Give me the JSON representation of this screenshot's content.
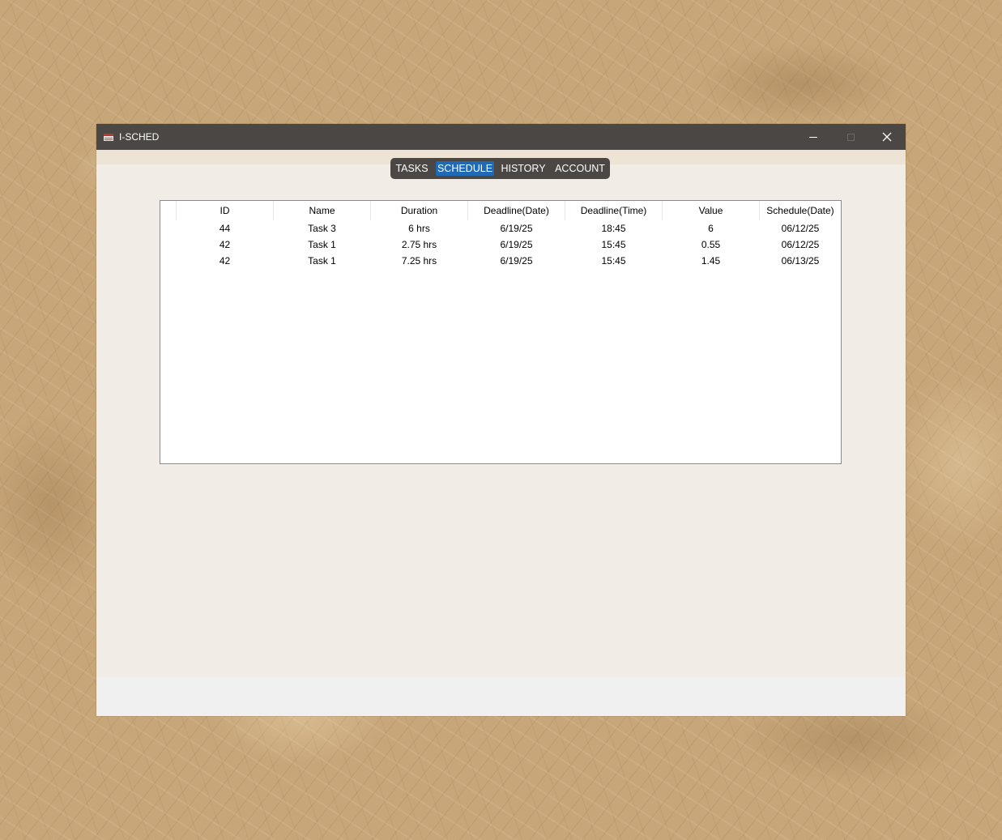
{
  "window": {
    "title": "I-SCHED"
  },
  "nav": {
    "tabs": [
      {
        "label": "TASKS",
        "active": false
      },
      {
        "label": "SCHEDULE",
        "active": true
      },
      {
        "label": "HISTORY",
        "active": false
      },
      {
        "label": "ACCOUNT",
        "active": false
      }
    ],
    "active_color": "#1f69b5"
  },
  "table": {
    "columns": [
      "ID",
      "Name",
      "Duration",
      "Deadline(Date)",
      "Deadline(Time)",
      "Value",
      "Schedule(Date)"
    ],
    "rows": [
      [
        "44",
        "Task 3",
        "6 hrs",
        "6/19/25",
        "18:45",
        "6",
        "06/12/25"
      ],
      [
        "42",
        "Task 1",
        "2.75 hrs",
        "6/19/25",
        "15:45",
        "0.55",
        "06/12/25"
      ],
      [
        "42",
        "Task 1",
        "7.25 hrs",
        "6/19/25",
        "15:45",
        "1.45",
        "06/13/25"
      ]
    ]
  },
  "icons": {
    "app": "calendar-icon",
    "minimize": "minimize-icon",
    "maximize": "maximize-icon",
    "close": "close-icon"
  }
}
